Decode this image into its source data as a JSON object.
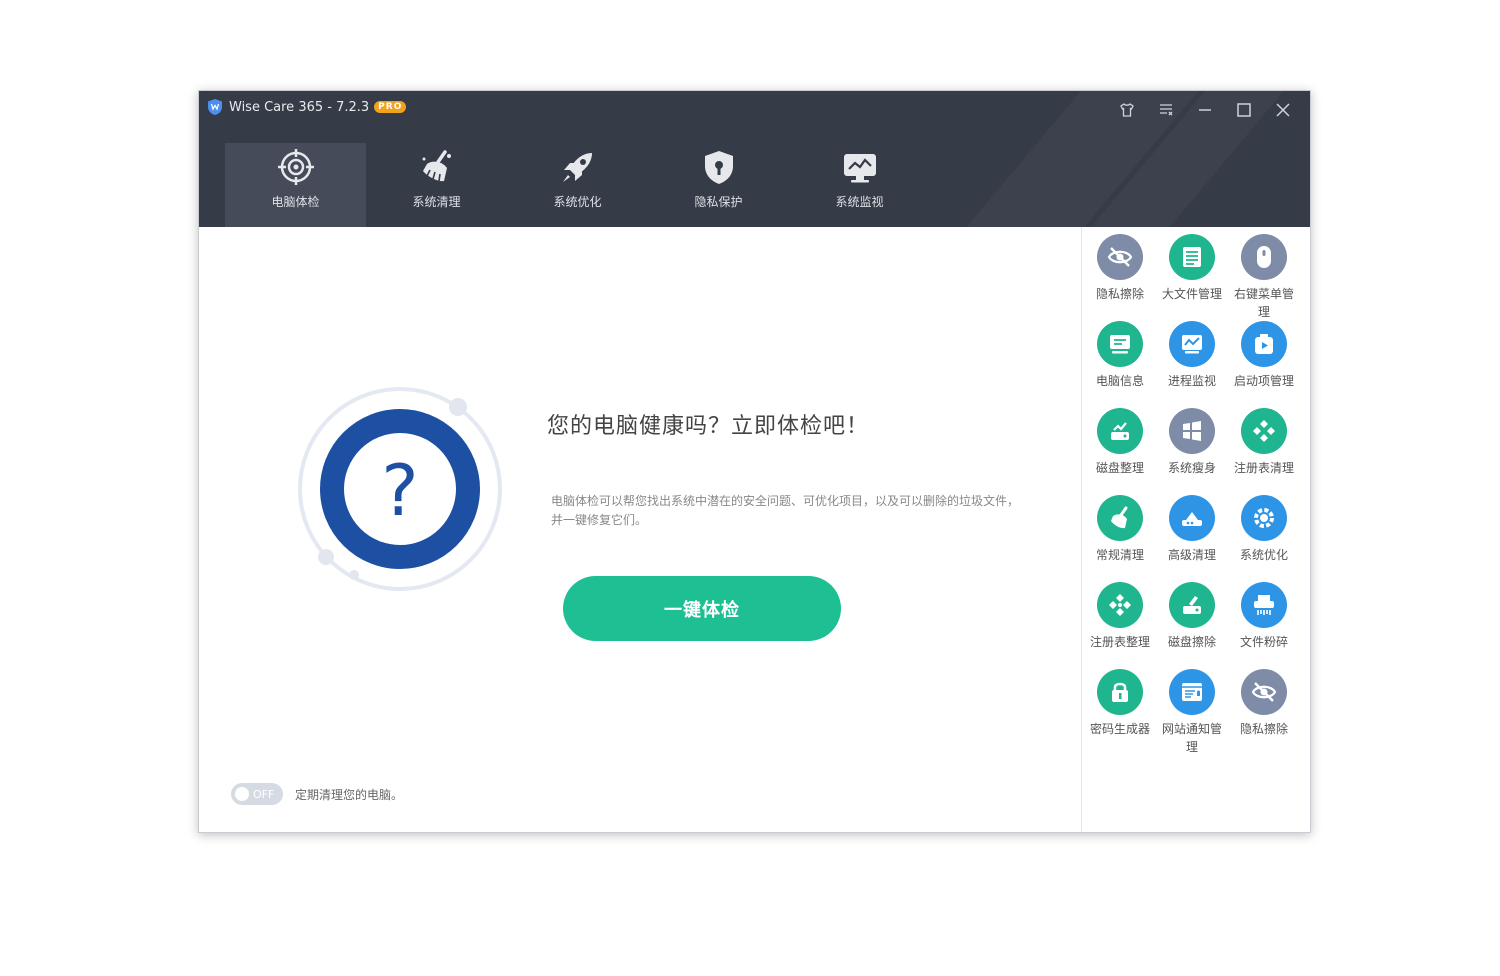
{
  "app": {
    "title": "Wise Care 365 - 7.2.3",
    "badge": "PRO"
  },
  "window_controls": [
    "skin-icon",
    "menu-icon",
    "minimize-icon",
    "maximize-icon",
    "close-icon"
  ],
  "tabs": [
    {
      "label": "电脑体检",
      "icon": "target-icon",
      "active": true
    },
    {
      "label": "系统清理",
      "icon": "broom-icon",
      "active": false
    },
    {
      "label": "系统优化",
      "icon": "rocket-icon",
      "active": false
    },
    {
      "label": "隐私保护",
      "icon": "shield-icon",
      "active": false
    },
    {
      "label": "系统监视",
      "icon": "monitor-icon",
      "active": false
    }
  ],
  "main": {
    "headline": "您的电脑健康吗？立即体检吧！",
    "description": "电脑体检可以帮您找出系统中潜在的安全问题、可优化项目，以及可以删除的垃圾文件，并一键修复它们。",
    "scan_button": "一键体检",
    "toggle_state": "OFF",
    "auto_clean_label": "定期清理您的电脑。"
  },
  "tools": [
    {
      "label": "隐私擦除",
      "icon": "eye-off-icon",
      "color": "#7e8ca8"
    },
    {
      "label": "大文件管理",
      "icon": "file-list-icon",
      "color": "#1fb58f"
    },
    {
      "label": "右键菜单管理",
      "icon": "mouse-icon",
      "color": "#7e8ca8"
    },
    {
      "label": "电脑信息",
      "icon": "computer-icon",
      "color": "#1fb58f"
    },
    {
      "label": "进程监视",
      "icon": "process-monitor-icon",
      "color": "#2e95e6"
    },
    {
      "label": "启动项管理",
      "icon": "startup-icon",
      "color": "#2e95e6"
    },
    {
      "label": "磁盘整理",
      "icon": "disk-defrag-icon",
      "color": "#1fb58f"
    },
    {
      "label": "系统瘦身",
      "icon": "windows-icon",
      "color": "#7e8ca8"
    },
    {
      "label": "注册表清理",
      "icon": "registry-clean-icon",
      "color": "#1fb58f"
    },
    {
      "label": "常规清理",
      "icon": "broom-icon",
      "color": "#1fb58f"
    },
    {
      "label": "高级清理",
      "icon": "advanced-clean-icon",
      "color": "#2e95e6"
    },
    {
      "label": "系统优化",
      "icon": "gear-icon",
      "color": "#2e95e6"
    },
    {
      "label": "注册表整理",
      "icon": "registry-defrag-icon",
      "color": "#1fb58f"
    },
    {
      "label": "磁盘擦除",
      "icon": "disk-eraser-icon",
      "color": "#1fb58f"
    },
    {
      "label": "文件粉碎",
      "icon": "shredder-icon",
      "color": "#2e95e6"
    },
    {
      "label": "密码生成器",
      "icon": "lock-icon",
      "color": "#1fb58f"
    },
    {
      "label": "网站通知管理",
      "icon": "web-notify-icon",
      "color": "#2e95e6"
    },
    {
      "label": "隐私擦除",
      "icon": "eye-off-icon",
      "color": "#7e8ca8"
    }
  ],
  "colors": {
    "titlebar": "#363b48",
    "accent_green": "#1fbf94",
    "ring_blue": "#1d4fa3",
    "pro_badge": "#f2a21b"
  }
}
